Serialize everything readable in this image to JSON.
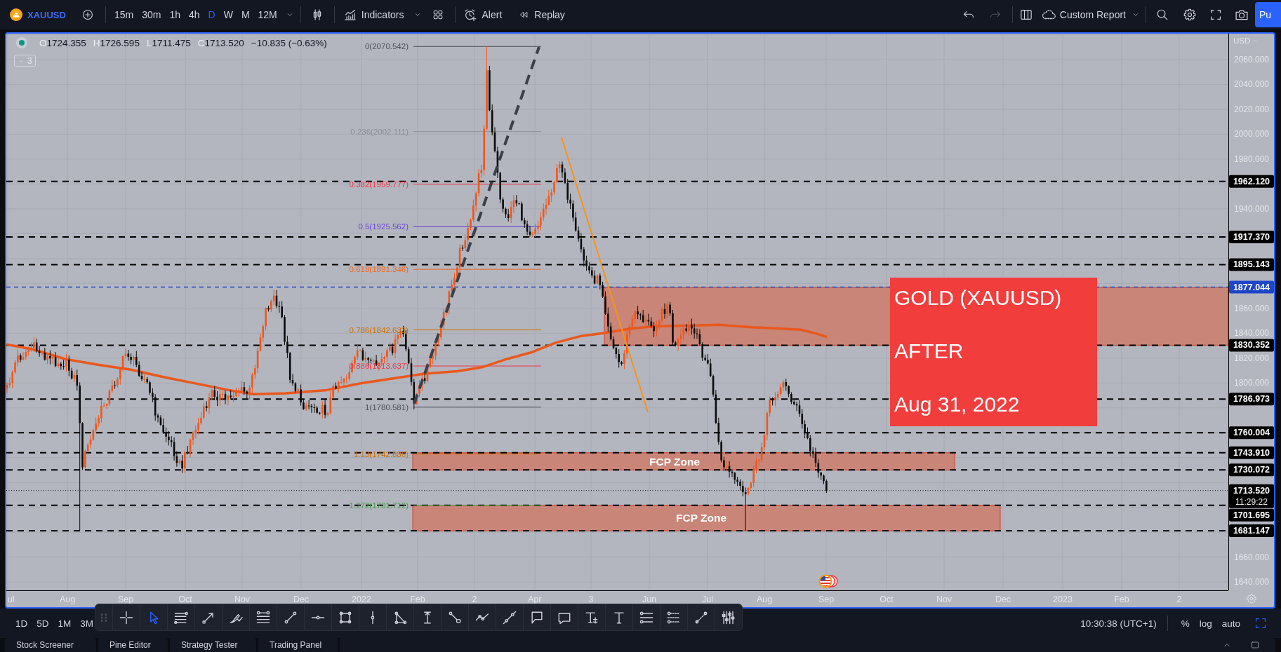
{
  "toolbar": {
    "symbol": "XAUUSD",
    "intervals": [
      {
        "label": "15m",
        "selected": false
      },
      {
        "label": "30m",
        "selected": false
      },
      {
        "label": "1h",
        "selected": false
      },
      {
        "label": "4h",
        "selected": false
      },
      {
        "label": "D",
        "selected": true
      },
      {
        "label": "W",
        "selected": false
      },
      {
        "label": "M",
        "selected": false
      },
      {
        "label": "12M",
        "selected": false
      }
    ],
    "indicators": "Indicators",
    "alert": "Alert",
    "replay": "Replay",
    "undo_disabled": false,
    "redo_disabled": true,
    "layout_name": "Custom Report",
    "publish": "Pu"
  },
  "legend": {
    "ohlc": [
      {
        "label": "O",
        "value": "1724.355"
      },
      {
        "label": "H",
        "value": "1726.595"
      },
      {
        "label": "L",
        "value": "1711.475"
      },
      {
        "label": "C",
        "value": "1713.520"
      }
    ],
    "change": "−10.835 (−0.63%)",
    "indicator_count": "3"
  },
  "chart": {
    "currency": "USD",
    "price_ticks": [
      "2060.000",
      "2040.000",
      "2020.000",
      "2000.000",
      "1980.000",
      "1940.000",
      "1860.000",
      "1840.000",
      "1820.000",
      "1800.000",
      "1660.000",
      "1640.000"
    ],
    "price_lines": [
      {
        "label": "1962.120",
        "kind": "dashed"
      },
      {
        "label": "1917.370",
        "kind": "dashed"
      },
      {
        "label": "1895.143",
        "kind": "dashed"
      },
      {
        "label": "1877.044",
        "kind": "highlighted"
      },
      {
        "label": "1830.352",
        "kind": "dashed"
      },
      {
        "label": "1786.973",
        "kind": "dashed"
      },
      {
        "label": "1760.004",
        "kind": "dashed"
      },
      {
        "label": "1743.910",
        "kind": "dashed"
      },
      {
        "label": "1730.072",
        "kind": "dashed"
      },
      {
        "label": "1713.520",
        "kind": "last_price",
        "countdown": "11:29:22"
      },
      {
        "label": "1701.695",
        "kind": "dashed"
      },
      {
        "label": "1681.147",
        "kind": "dashed"
      }
    ],
    "fib_levels": [
      {
        "label": "0(2070.542)",
        "color": "#4e515b"
      },
      {
        "label": "0.236(2002.111)",
        "color": "#8a8d96"
      },
      {
        "label": "0.382(1959.777)",
        "color": "#f23645"
      },
      {
        "label": "0.5(1925.562)",
        "color": "#6a46d4"
      },
      {
        "label": "0.618(1891.346)",
        "color": "#f2661d"
      },
      {
        "label": "0.786(1842.633)",
        "color": "#cf7000"
      },
      {
        "label": "0.886(1813.637)",
        "color": "#f23645"
      },
      {
        "label": "1(1780.581)",
        "color": "#4e515b"
      },
      {
        "label": "1.13(1742.886)",
        "color": "#cf7000"
      },
      {
        "label": "1.272(1701.712)",
        "color": "#43a047"
      }
    ],
    "zones": [
      {
        "label": "FCP Zone"
      },
      {
        "label": "FCP Zone"
      }
    ],
    "note": [
      "GOLD (XAUUSD)",
      "AFTER",
      "Aug 31, 2022"
    ],
    "time_labels": [
      "ul",
      "Aug",
      "Sep",
      "Oct",
      "Nov",
      "Dec",
      "2022",
      "Feb",
      "2",
      "Apr",
      "3",
      "Jun",
      "Jul",
      "Aug",
      "Sep",
      "Oct",
      "Nov",
      "Dec",
      "2023",
      "Feb",
      "2"
    ]
  },
  "drawing_tools": [
    {
      "selected": false
    },
    {
      "selected": true
    },
    {
      "selected": false
    },
    {
      "selected": false
    },
    {
      "selected": false
    },
    {
      "selected": false
    },
    {
      "selected": false
    },
    {
      "selected": false
    },
    {
      "selected": false
    },
    {
      "selected": false
    },
    {
      "selected": false
    },
    {
      "selected": false
    },
    {
      "selected": false
    },
    {
      "selected": false
    },
    {
      "selected": false
    },
    {
      "selected": false
    },
    {
      "selected": false
    },
    {
      "selected": false
    },
    {
      "selected": false
    },
    {
      "selected": false
    },
    {
      "selected": false
    },
    {
      "selected": false
    },
    {
      "selected": false
    }
  ],
  "bottom_bar": {
    "ranges": [
      "1D",
      "5D",
      "1M",
      "3M"
    ],
    "clock": "10:30:38 (UTC+1)",
    "scale_options": [
      "%",
      "log",
      "auto"
    ]
  },
  "panel_tabs": [
    "Stock Screener",
    "Pine Editor",
    "Strategy Tester",
    "Trading Panel"
  ]
}
